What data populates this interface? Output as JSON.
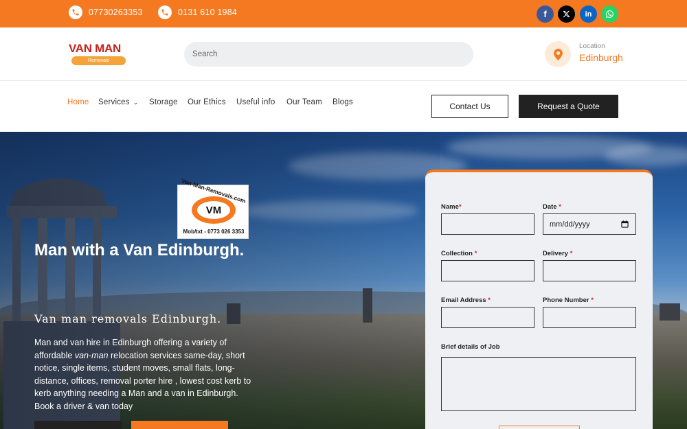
{
  "topbar": {
    "phone1": "07730263353",
    "phone2": "0131 610 1984",
    "social": [
      "facebook",
      "x",
      "linkedin",
      "whatsapp"
    ],
    "accent": "#f47920"
  },
  "header": {
    "logo_text": "VAN MAN",
    "logo_sub": "Removals",
    "search_placeholder": "Search",
    "location_label": "Location",
    "location_value": "Edinburgh"
  },
  "nav": {
    "items": [
      "Home",
      "Services",
      "Storage",
      "Our Ethics",
      "Useful info",
      "Our Team",
      "Blogs"
    ],
    "contact_label": "Contact Us",
    "quote_label": "Request a Quote"
  },
  "hero": {
    "badge_top": "Van-Man-Removals.com",
    "badge_logo": "VM",
    "badge_bottom": "Mob/txt - 0773 026 3353",
    "title": "Man with a Van Edinburgh.",
    "subtitle": "Van man removals Edinburgh.",
    "desc_part1": "Man and van hire in Edinburgh offering a variety of affordable ",
    "desc_em": "van-man",
    "desc_part2": " relocation services same-day, short notice, single items, student moves, small flats, long- distance, offices, removal porter hire , lowest cost kerb to kerb anything needing a Man and a van in Edinburgh. Book a driver & van today"
  },
  "form": {
    "name_label": "Name",
    "date_label": "Date",
    "date_placeholder": "mm/dd/yyyy",
    "collection_label": "Collection",
    "delivery_label": "Delivery",
    "email_label": "Email Address",
    "phone_label": "Phone Number",
    "details_label": "Brief details of Job",
    "required_mark": "*"
  }
}
